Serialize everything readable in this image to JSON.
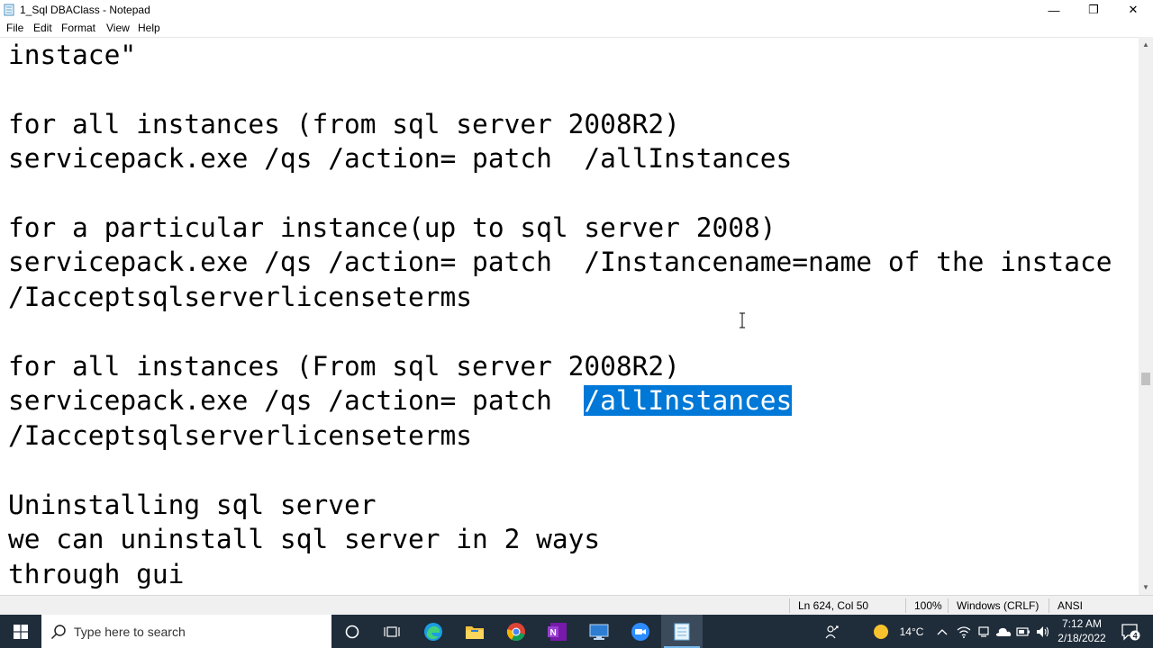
{
  "window": {
    "title": "1_Sql DBAClass - Notepad",
    "minimize_glyph": "—",
    "maximize_glyph": "❐",
    "close_glyph": "✕"
  },
  "menu": [
    "File",
    "Edit",
    "Format",
    "View",
    "Help"
  ],
  "editor": {
    "lines": [
      "instace\"",
      "",
      "for all instances (from sql server 2008R2)",
      "servicepack.exe /qs /action= patch  /allInstances",
      "",
      "for a particular instance(up to sql server 2008)",
      "servicepack.exe /qs /action= patch  /Instancename=name of the instace",
      "/Iacceptsqlserverlicenseterms",
      "",
      "for all instances (From sql server 2008R2)",
      "servicepack.exe /qs /action= patch  ",
      "/Iacceptsqlserverlicenseterms",
      "",
      "Uninstalling sql server",
      "we can uninstall sql server in 2 ways",
      "through gui"
    ],
    "selected_text": "/allInstances",
    "selection_color": "#0078d7"
  },
  "statusbar": {
    "position": "Ln 624, Col 50",
    "zoom": "100%",
    "line_ending": "Windows (CRLF)",
    "encoding": "ANSI"
  },
  "taskbar": {
    "search_placeholder": "Type here to search",
    "apps": [
      "cortana-icon",
      "task-view-icon",
      "edge-icon",
      "file-explorer-icon",
      "chrome-icon",
      "onenote-icon",
      "remote-desktop-icon",
      "zoom-icon",
      "notepad-icon"
    ],
    "weather": "14°C",
    "time": "7:12 AM",
    "date": "2/18/2022",
    "notification_count": "4",
    "background": "#1f2c3a"
  }
}
